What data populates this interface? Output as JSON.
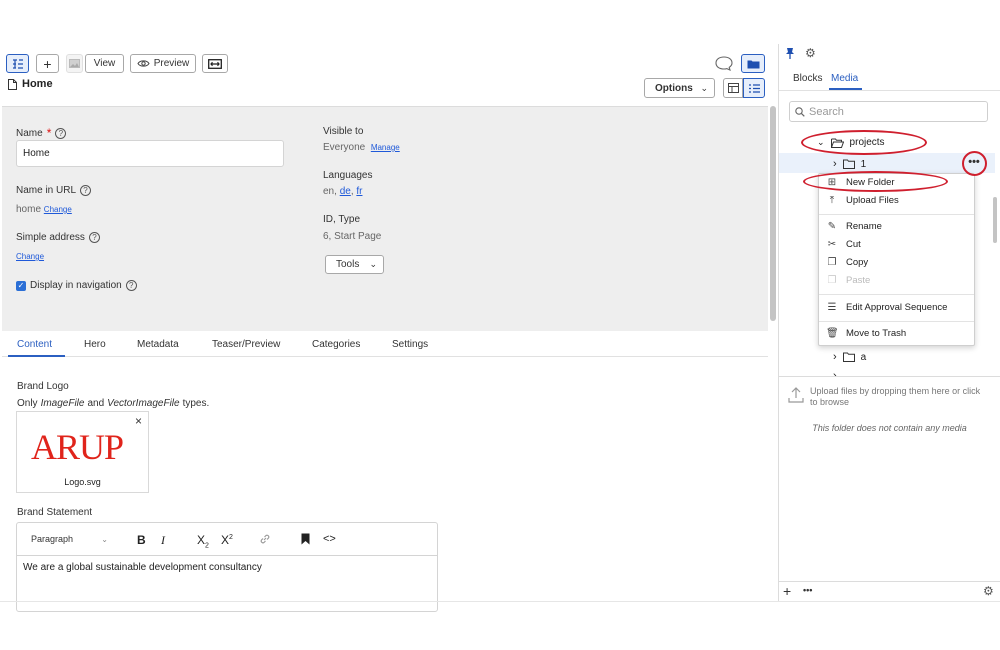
{
  "toolbar": {
    "view_label": "View",
    "preview_label": "Preview"
  },
  "breadcrumb": {
    "title": "Home"
  },
  "options_label": "Options",
  "properties": {
    "name_label": "Name",
    "required_mark": "*",
    "name_value": "Home",
    "url_label": "Name in URL",
    "url_value": "home",
    "change_label": "Change",
    "simple_address_label": "Simple address",
    "display_nav_label": "Display in navigation",
    "visible_to_label": "Visible to",
    "visible_to_value": "Everyone",
    "manage_label": "Manage",
    "languages_label": "Languages",
    "languages_prefix": "en,",
    "lang_de": "de",
    "lang_sep": ",",
    "lang_fr": "fr",
    "id_type_label": "ID, Type",
    "id_type_value": "6, Start Page",
    "tools_label": "Tools"
  },
  "tabs": [
    "Content",
    "Hero",
    "Metadata",
    "Teaser/Preview",
    "Categories",
    "Settings"
  ],
  "content": {
    "brand_logo_label": "Brand Logo",
    "only_label": "Only",
    "type1": "ImageFile",
    "and_label": "and",
    "type2": "VectorImageFile",
    "types_suffix": "types.",
    "logo_text": "ARUP",
    "logo_filename": "Logo.svg",
    "brand_statement_label": "Brand Statement",
    "paragraph_label": "Paragraph",
    "statement_text": "We are a global sustainable development consultancy"
  },
  "right_panel": {
    "tab_blocks": "Blocks",
    "tab_media": "Media",
    "search_placeholder": "Search",
    "tree": {
      "projects": "projects",
      "folder_1": "1",
      "folder_a": "a"
    },
    "context_menu": {
      "new_folder": "New Folder",
      "upload_files": "Upload Files",
      "rename": "Rename",
      "cut": "Cut",
      "copy": "Copy",
      "paste": "Paste",
      "edit_approval": "Edit Approval Sequence",
      "move_to_trash": "Move to Trash"
    },
    "upload_hint": "Upload files by dropping them here or click to browse",
    "empty_text": "This folder does not contain any media"
  },
  "colors": {
    "accent": "#2b5fc1",
    "highlight": "#cf1f2e",
    "logo_red": "#e0241b",
    "panel_bg": "#eeeeee"
  }
}
